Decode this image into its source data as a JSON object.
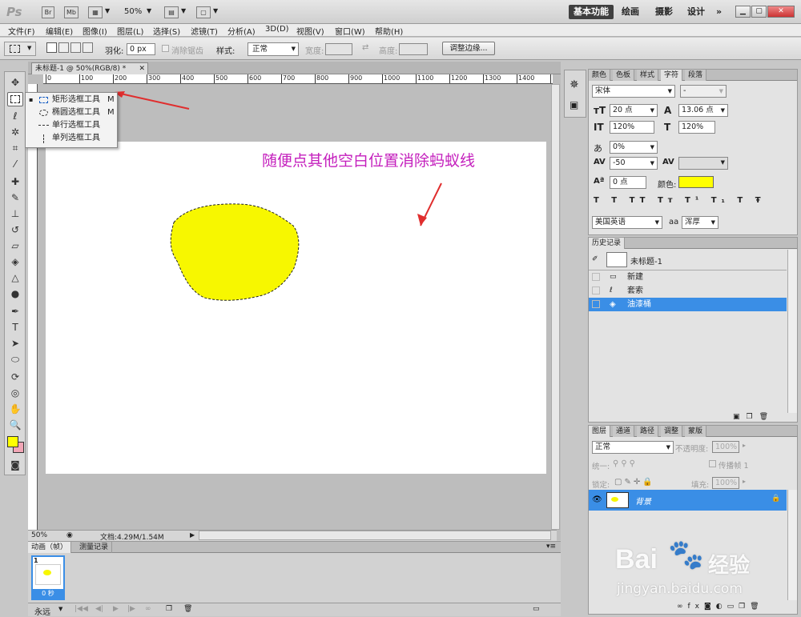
{
  "app": {
    "logo": "Ps",
    "zoom": "50%",
    "workspaces": [
      "基本功能",
      "绘画",
      "摄影",
      "设计"
    ],
    "more": "»"
  },
  "menu": [
    "文件(F)",
    "编辑(E)",
    "图像(I)",
    "图层(L)",
    "选择(S)",
    "滤镜(T)",
    "分析(A)",
    "3D(D)",
    "视图(V)",
    "窗口(W)",
    "帮助(H)"
  ],
  "options": {
    "feather_label": "羽化:",
    "feather_value": "0 px",
    "antialias_label": "消除锯齿",
    "style_label": "样式:",
    "style_value": "正常",
    "width_label": "宽度:",
    "height_label": "高度:",
    "refine_button": "调整边缘..."
  },
  "document": {
    "tab_title": "未标题-1 @ 50%(RGB/8) *",
    "ruler_marks": [
      "0",
      "100",
      "200",
      "300",
      "400",
      "500",
      "600",
      "700",
      "800",
      "900",
      "1000",
      "1100",
      "1200",
      "1300",
      "1400",
      "15"
    ],
    "annotation": "随便点其他空白位置消除蚂蚁线",
    "status_zoom": "50%",
    "doc_info": "文档:4.29M/1.54M"
  },
  "tool_popup": [
    {
      "label": "矩形选框工具",
      "key": "M"
    },
    {
      "label": "椭圆选框工具",
      "key": "M"
    },
    {
      "label": "单行选框工具",
      "key": ""
    },
    {
      "label": "单列选框工具",
      "key": ""
    }
  ],
  "colors": {
    "foreground": "#ffff00",
    "background": "#f2a6b6",
    "fill": "#f7f700",
    "accent": "#3a8ee6"
  },
  "char_panel": {
    "tabs": [
      "颜色",
      "色板",
      "样式",
      "字符",
      "段落"
    ],
    "font": "宋体",
    "style": "-",
    "size": "20 点",
    "leading": "13.06 点",
    "vscale": "120%",
    "hscale": "120%",
    "tracking_pct": "0%",
    "tracking": "-50",
    "baseline": "0 点",
    "color_label": "颜色:",
    "language": "美国英语",
    "aa_label": "a",
    "aa": "浑厚"
  },
  "history": {
    "tab": "历史记录",
    "snapshot": "未标题-1",
    "items": [
      "新建",
      "套索",
      "油漆桶"
    ]
  },
  "layers": {
    "tabs": [
      "图层",
      "通道",
      "路径",
      "调整",
      "蒙版"
    ],
    "blend": "正常",
    "opacity_label": "不透明度:",
    "opacity": "100%",
    "unify_label": "统一:",
    "propagate": "传播帧 1",
    "lock_label": "锁定:",
    "fill_label": "填充:",
    "fill": "100%",
    "layer_name": "背景"
  },
  "animation": {
    "tabs": [
      "动画（帧）",
      "测量记录"
    ],
    "frame_number": "1",
    "frame_time": "0 秒",
    "loop": "永远"
  },
  "watermark": {
    "brand": "Bai",
    "brand_suffix": "经验",
    "url": "jingyan.baidu.com"
  }
}
